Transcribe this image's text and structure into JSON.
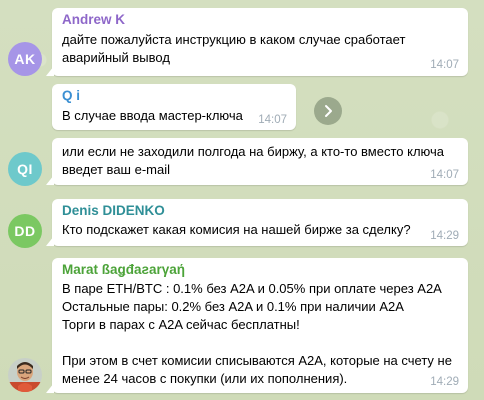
{
  "colors": {
    "andrew_avatar": "#a695e7",
    "qi_avatar": "#6ec9cb",
    "denis_avatar": "#7bc862",
    "andrew_name": "#8e67c9",
    "qi_name": "#3a8fd2",
    "denis_name": "#2f8f97",
    "marat_name": "#4ca339",
    "time": "#a0acb6"
  },
  "messages": [
    {
      "avatar_initials": "AK",
      "sender": "Andrew K",
      "lines": [
        "дайте пожалуйста инструкцию в каком случае сработает",
        "аварийный вывод"
      ],
      "time": "14:07"
    },
    {
      "sender": "Q i",
      "lines": [
        "В случае ввода мастер-ключа"
      ],
      "time": "14:07",
      "action_icon": "chevron-right-icon"
    },
    {
      "avatar_initials": "QI",
      "lines": [
        "или если не заходили полгода на биржу, а кто-то вместо ключа",
        "введет ваш e-mail"
      ],
      "time": "14:07"
    },
    {
      "avatar_initials": "DD",
      "sender": "Denis DIDENKO",
      "lines": [
        "Кто подскажет какая комисия на нашей бирже за сделку?"
      ],
      "time": "14:29"
    },
    {
      "avatar_icon": "user-photo-icon",
      "sender": "Marat ßaǥđaƨarγaή",
      "lines": [
        "В паре ETH/BTC : 0.1% без A2A и 0.05% при оплате через A2A",
        "Остальные пары: 0.2% без A2A и 0.1% при наличии A2A",
        "Торги в парах с A2A сейчас бесплатны!",
        "",
        "При этом в счет комисии списываются A2A, которые на счету не",
        "менее 24 часов с покупки (или их пополнения)."
      ],
      "time": "14:29"
    }
  ]
}
